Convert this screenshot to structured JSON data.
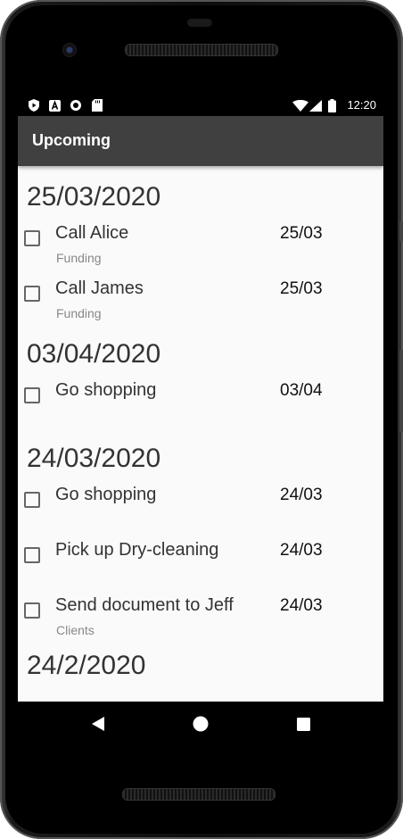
{
  "status_bar": {
    "time": "12:20",
    "left_icons": [
      "play-protect-icon",
      "a-icon",
      "circle-icon",
      "sd-card-icon"
    ],
    "right_icons": [
      "wifi-icon",
      "signal-icon",
      "battery-icon"
    ]
  },
  "app_bar": {
    "title": "Upcoming"
  },
  "groups": [
    {
      "date": "25/03/2020",
      "tasks": [
        {
          "title": "Call Alice",
          "category": "Funding",
          "date": "25/03"
        },
        {
          "title": "Call James",
          "category": "Funding",
          "date": "25/03"
        }
      ]
    },
    {
      "date": "03/04/2020",
      "tasks": [
        {
          "title": "Go shopping",
          "category": "",
          "date": "03/04"
        }
      ]
    },
    {
      "date": "24/03/2020",
      "tasks": [
        {
          "title": "Go shopping",
          "category": "",
          "date": "24/03"
        },
        {
          "title": "Pick up Dry-cleaning",
          "category": "",
          "date": "24/03"
        },
        {
          "title": "Send document to Jeff",
          "category": "Clients",
          "date": "24/03"
        }
      ]
    },
    {
      "date": "24/2/2020",
      "tasks": []
    }
  ],
  "nav_bar": {
    "buttons": [
      "back-icon",
      "home-icon",
      "recents-icon"
    ]
  },
  "colors": {
    "app_bar": "#404040",
    "background": "#fafafa",
    "status_bar": "#000000"
  }
}
